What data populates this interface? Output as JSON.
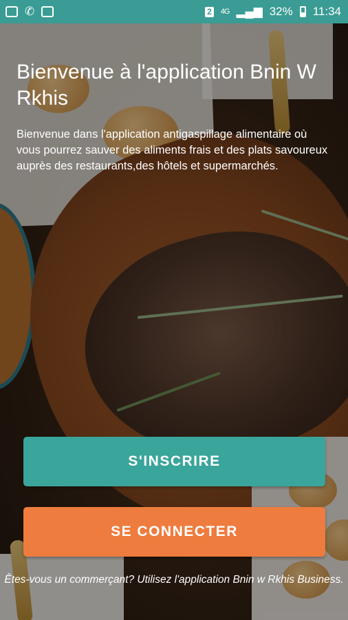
{
  "status_bar": {
    "chip": "2",
    "network": "4G",
    "battery_percent": "32%",
    "time": "11:34",
    "icons": [
      "gallery-icon",
      "call-forward-icon",
      "email-icon",
      "sim-icon",
      "signal-icon",
      "battery-icon"
    ]
  },
  "welcome": {
    "title": "Bienvenue à l'application Bnin W Rkhis",
    "description": "Bienvenue dans l'application antigaspillage alimentaire où vous pourrez sauver des aliments frais et des plats savoureux auprès des restaurants,des hôtels et supermarchés."
  },
  "actions": {
    "signup_label": "S'INSCRIRE",
    "login_label": "SE CONNECTER"
  },
  "footer": {
    "business_note": "Êtes-vous un commerçant? Utilisez l'application Bnin w Rkhis Business."
  },
  "colors": {
    "status_bar": "#3a9c94",
    "signup_button": "#3aa59b",
    "login_button": "#ee7c3e",
    "text": "#ffffff"
  }
}
